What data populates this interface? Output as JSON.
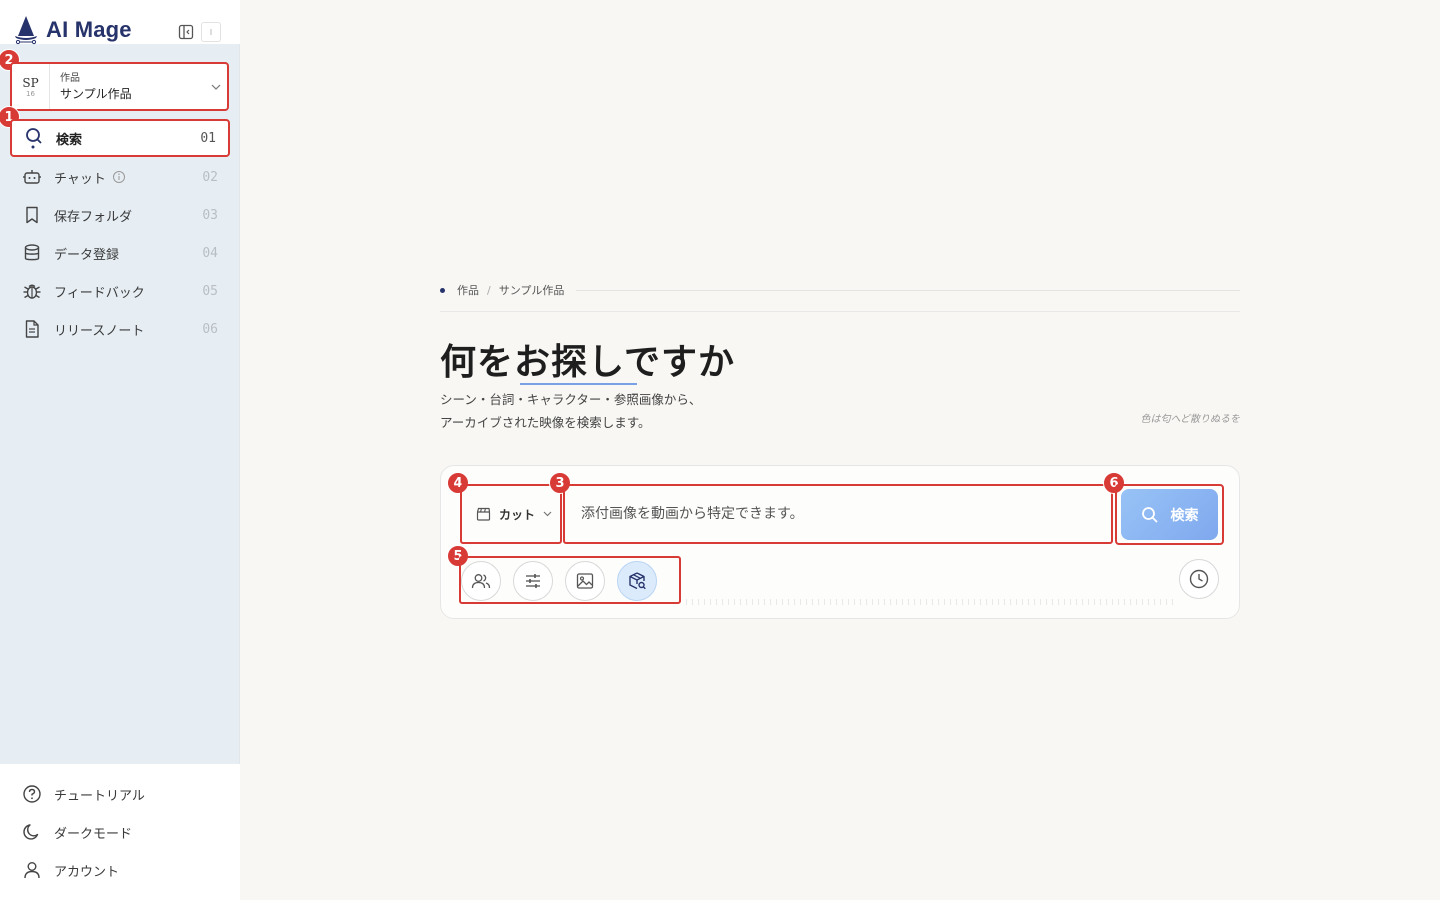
{
  "app": {
    "name": "AI Mage"
  },
  "project": {
    "abbr": "SP",
    "number": "16",
    "category": "作品",
    "name": "サンプル作品"
  },
  "nav": {
    "items": [
      {
        "label": "検索",
        "num": "01"
      },
      {
        "label": "チャット",
        "num": "02"
      },
      {
        "label": "保存フォルダ",
        "num": "03"
      },
      {
        "label": "データ登録",
        "num": "04"
      },
      {
        "label": "フィードバック",
        "num": "05"
      },
      {
        "label": "リリースノート",
        "num": "06"
      }
    ]
  },
  "bottom_nav": {
    "items": [
      {
        "label": "チュートリアル"
      },
      {
        "label": "ダークモード"
      },
      {
        "label": "アカウント"
      }
    ]
  },
  "breadcrumb": {
    "items": [
      "作品",
      "サンプル作品"
    ]
  },
  "hero": {
    "title_a": "何を",
    "title_b": "お探し",
    "title_c": "ですか",
    "subtitle": "シーン・台詞・キャラクター・参照画像から、アーカイブされた映像を検索します。",
    "tagline": "色は匂へど散りぬるを"
  },
  "search": {
    "mode_label": "カット",
    "placeholder": "添付画像を動画から特定できます。",
    "button_label": "検索"
  },
  "badges": [
    "1",
    "2",
    "3",
    "4",
    "5",
    "6"
  ],
  "colors": {
    "accent": "#27336b",
    "highlight": "#d83a36",
    "button": "#8bb4f1"
  }
}
